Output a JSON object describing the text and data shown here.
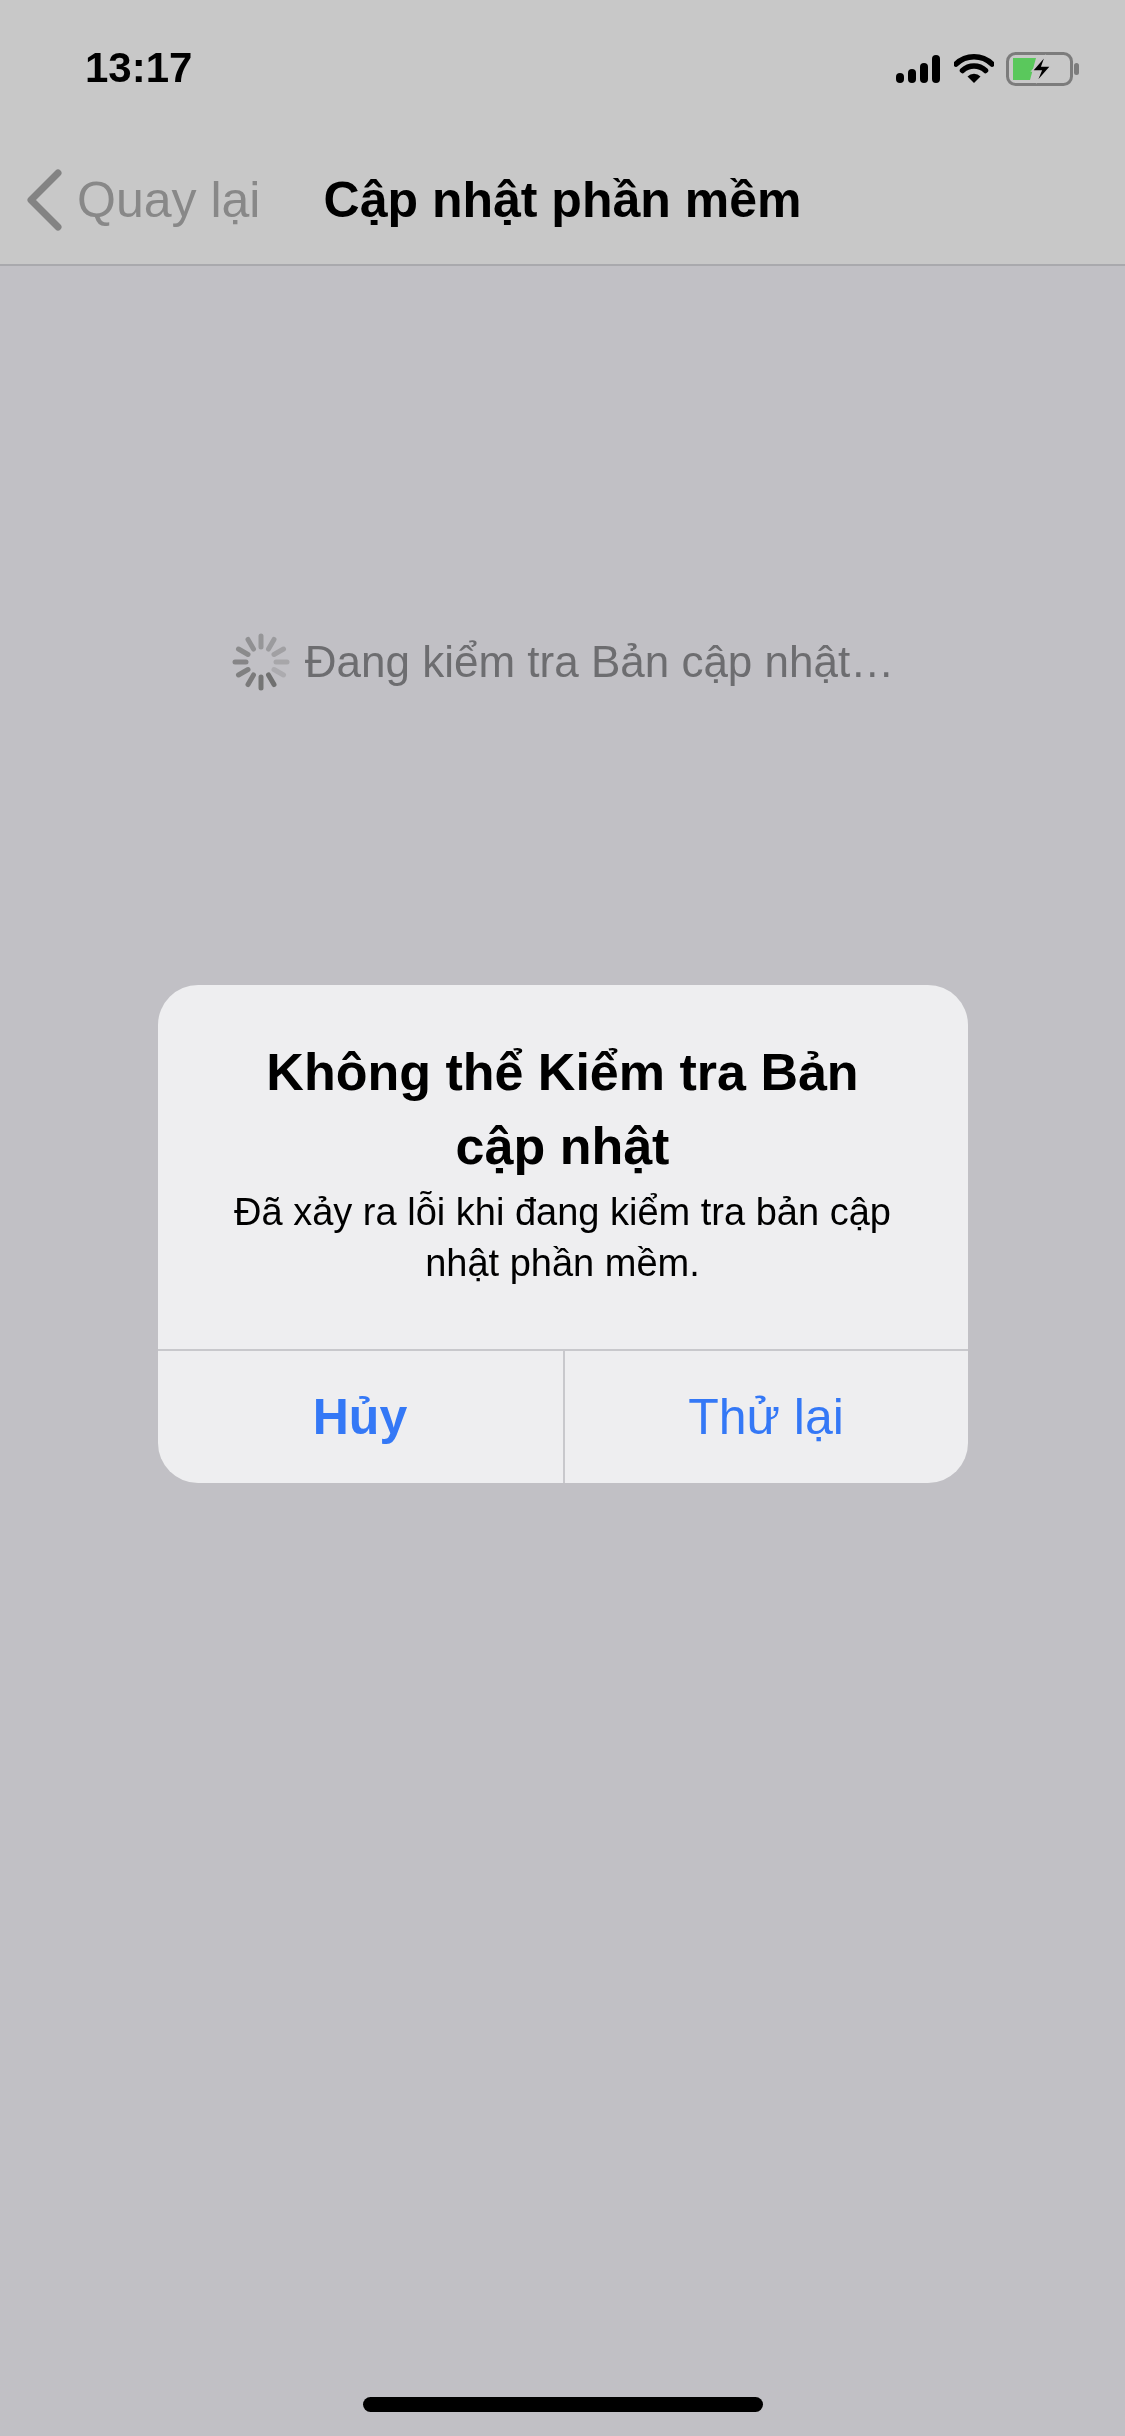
{
  "status_bar": {
    "time": "13:17"
  },
  "nav_bar": {
    "back_label": "Quay lại",
    "title": "Cập nhật phần mềm"
  },
  "content": {
    "status_text": "Đang kiểm tra Bản cập nhật…"
  },
  "alert": {
    "title": "Không thể Kiểm tra Bản cập nhật",
    "message": "Đã xảy ra lỗi khi đang kiểm tra bản cập nhật phần mềm.",
    "buttons": [
      {
        "label": "Hủy",
        "kind": "cancel"
      },
      {
        "label": "Thử lại",
        "kind": "action"
      }
    ]
  }
}
